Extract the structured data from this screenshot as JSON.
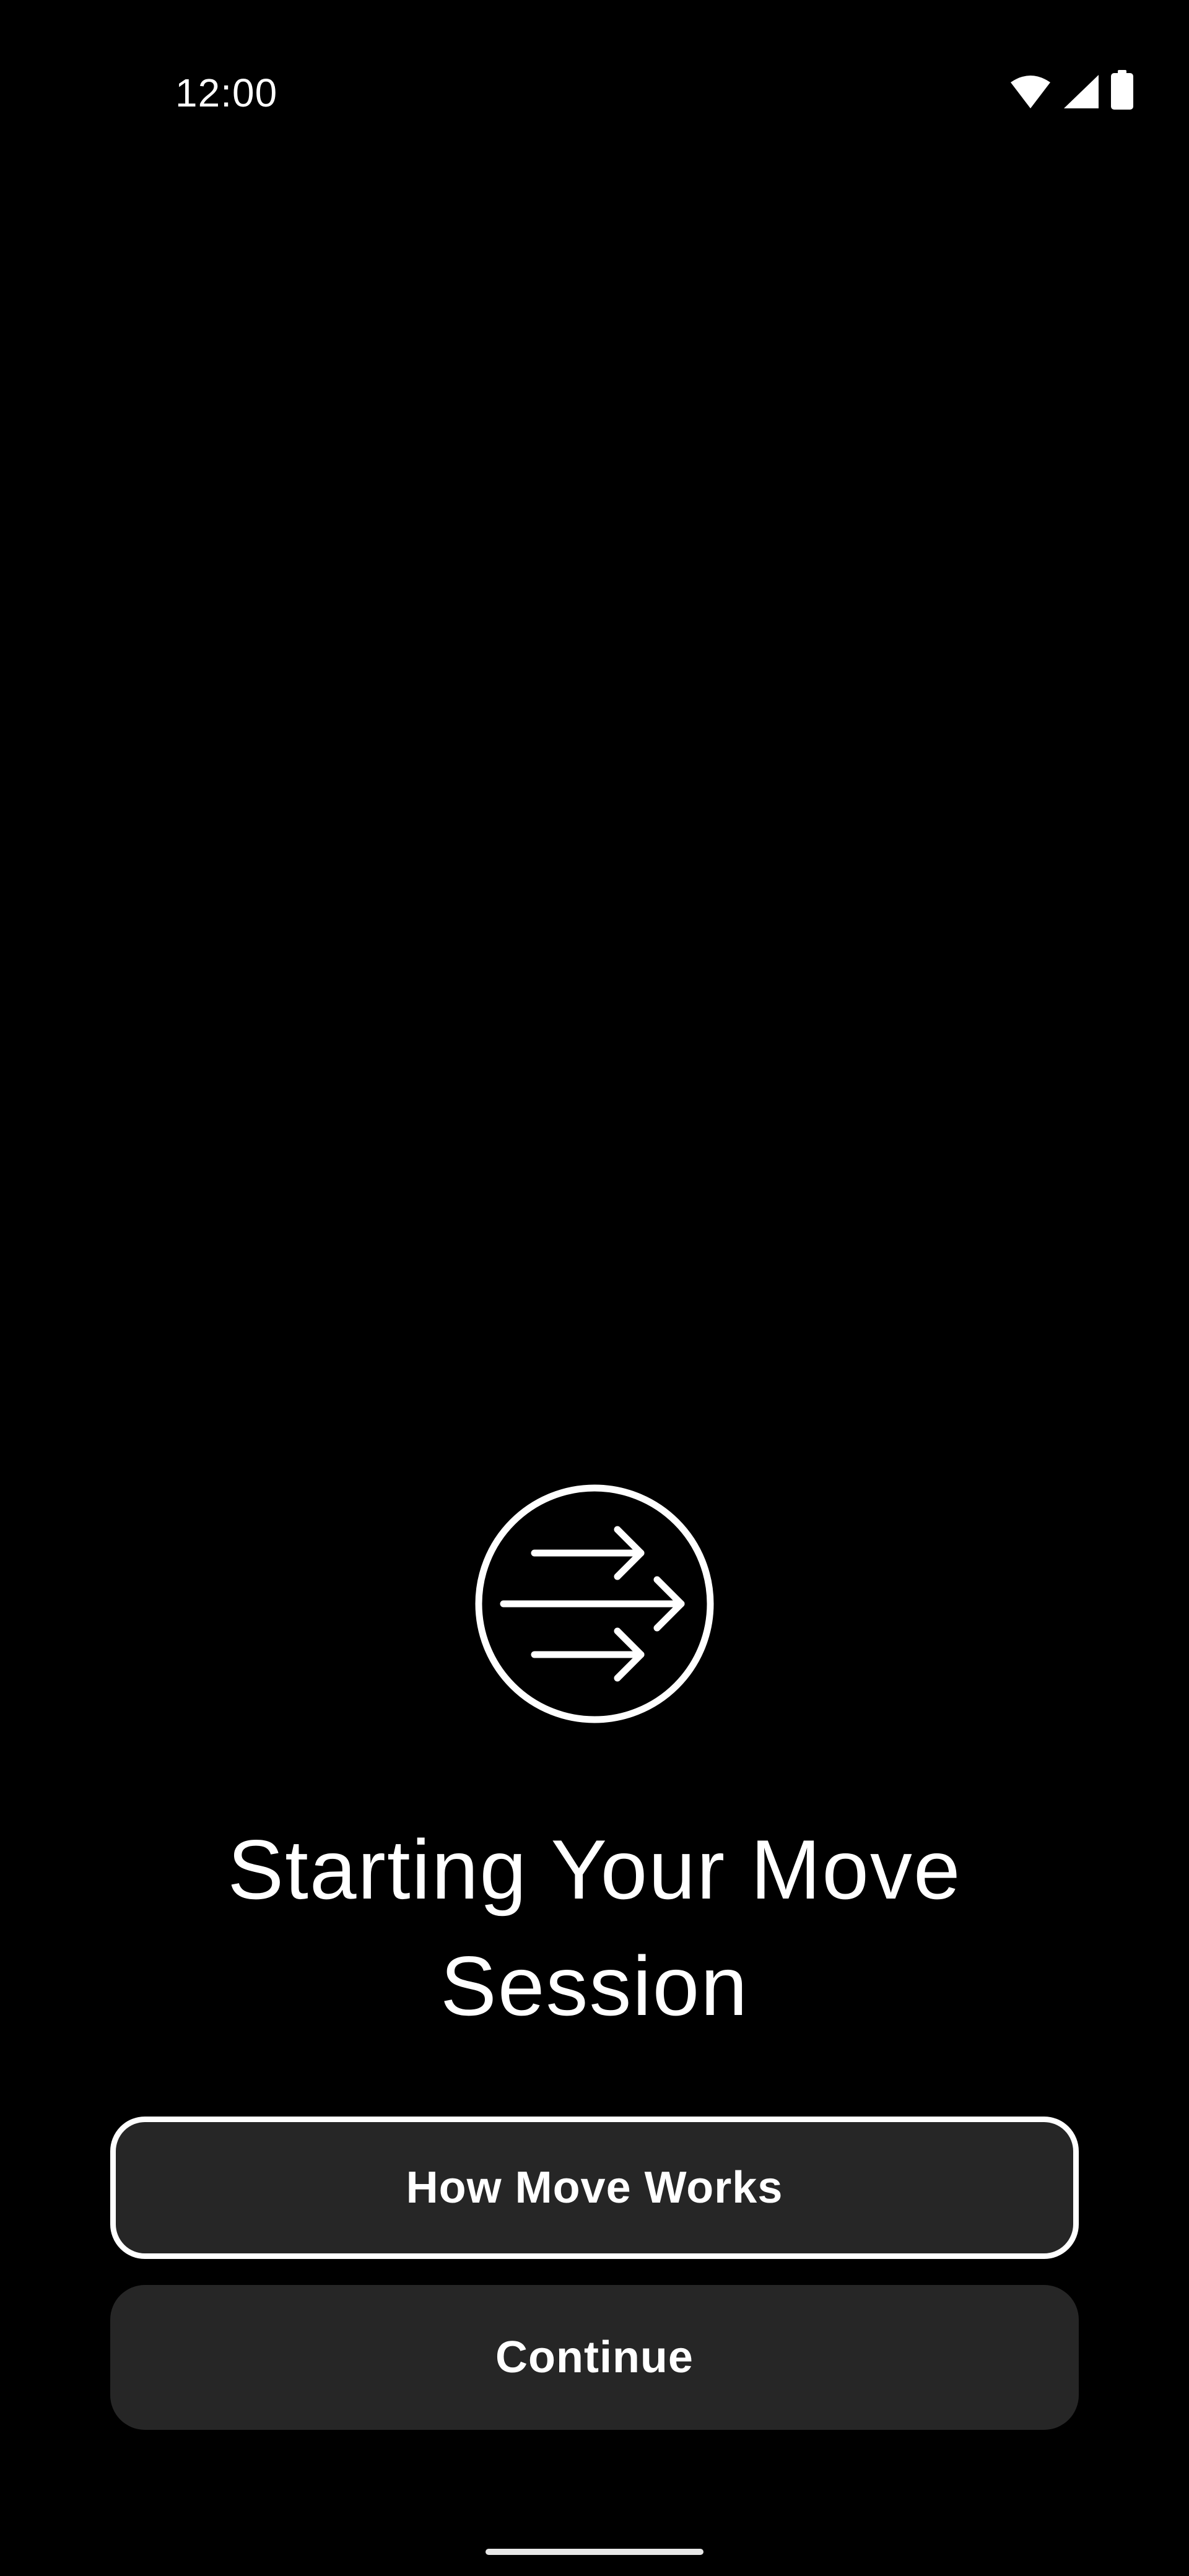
{
  "status_bar": {
    "time": "12:00",
    "icons": [
      "wifi-icon",
      "cellular-signal-icon",
      "battery-icon"
    ]
  },
  "illustration": {
    "description_icon": "grid-lines-graphic"
  },
  "move_icon": "arrows-in-circle-icon",
  "title": "Starting Your Move Session",
  "buttons": {
    "how_move_works": "How Move Works",
    "continue": "Continue"
  },
  "colors": {
    "background": "#000000",
    "button_fill": "#262626",
    "text": "#ffffff",
    "button_outline": "#ffffff"
  }
}
